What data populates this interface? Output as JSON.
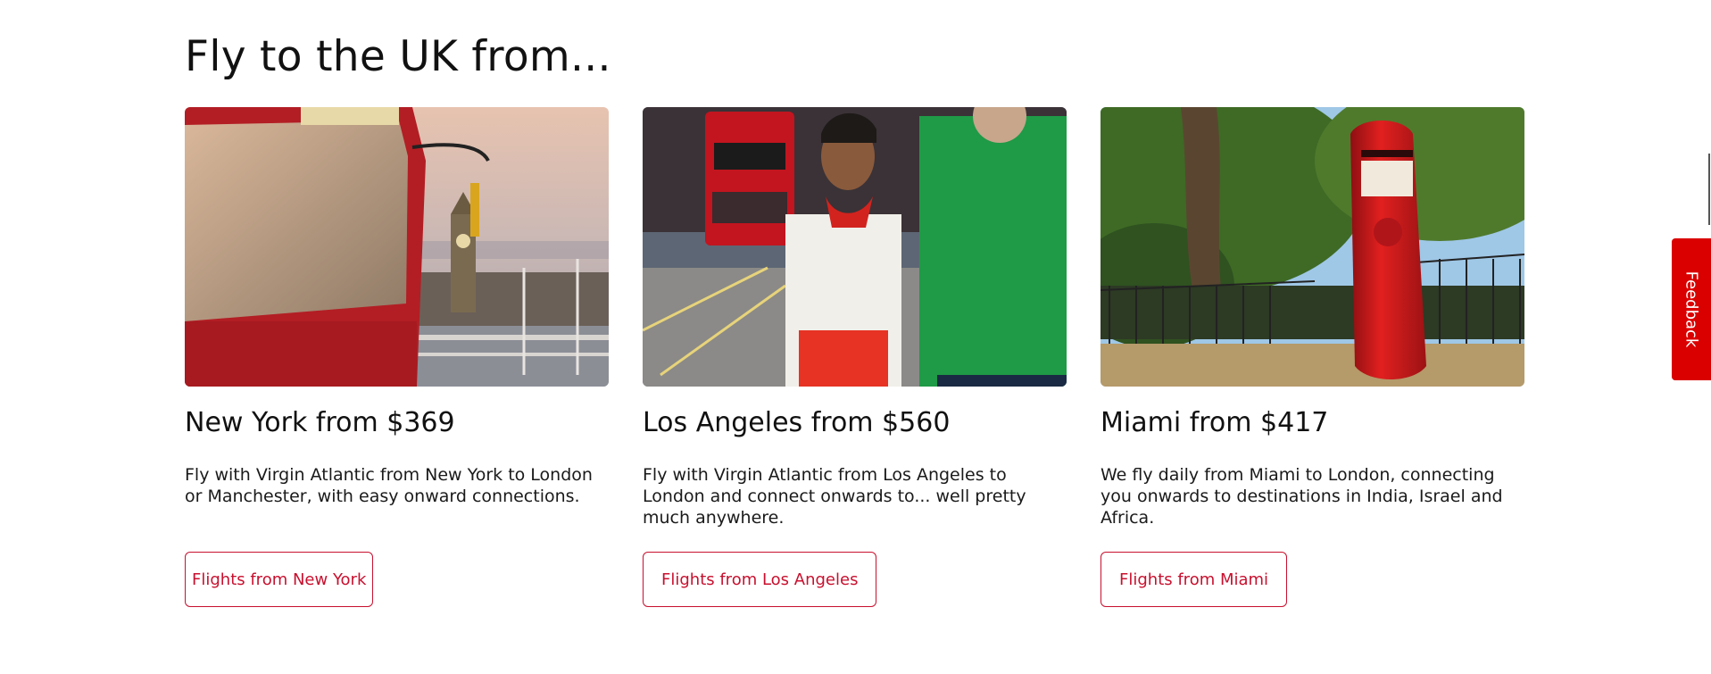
{
  "section": {
    "heading": "Fly to the UK from..."
  },
  "cards": [
    {
      "title": "New York from $369",
      "description": "Fly with Virgin Atlantic from New York to London or Manchester, with easy onward connections.",
      "button_label": "Flights from New York"
    },
    {
      "title": "Los Angeles from $560",
      "description": "Fly with Virgin Atlantic from Los Angeles to London and connect onwards to... well pretty much anywhere.",
      "button_label": "Flights from Los Angeles"
    },
    {
      "title": "Miami from $417",
      "description": "We fly daily from Miami to London, connecting you onwards to destinations in India, Israel and Africa.",
      "button_label": "Flights from Miami"
    }
  ],
  "feedback": {
    "label": "Feedback"
  },
  "colors": {
    "brand_red": "#c8102e",
    "feedback_red": "#da0000"
  }
}
